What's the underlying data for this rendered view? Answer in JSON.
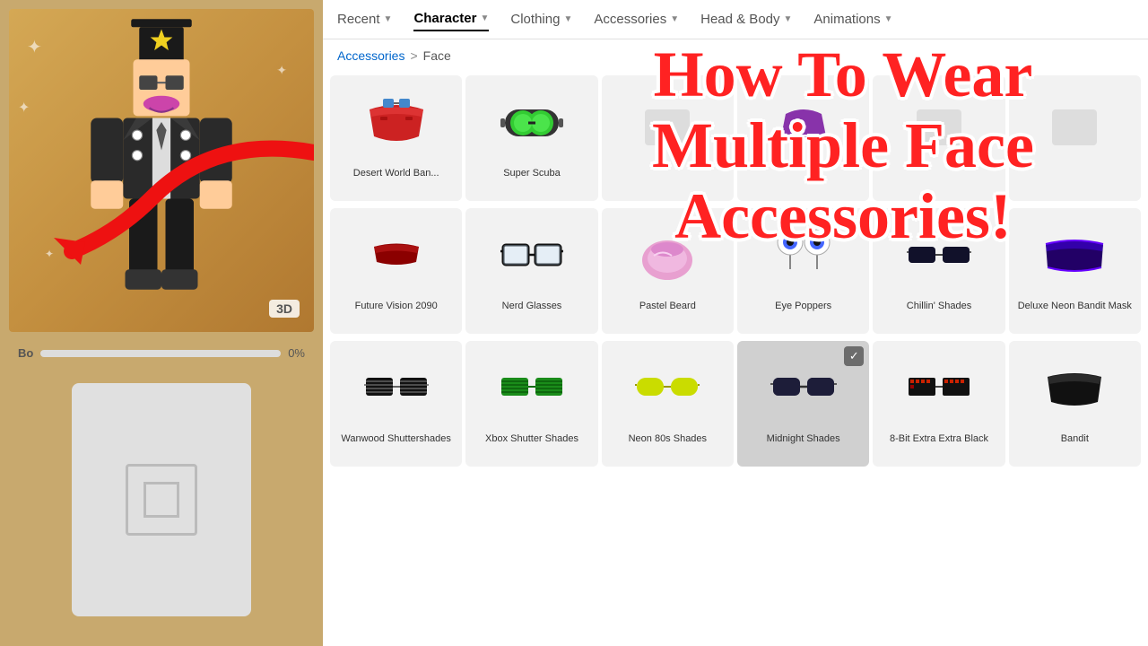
{
  "nav": {
    "items": [
      {
        "label": "Recent",
        "hasChevron": true,
        "active": false
      },
      {
        "label": "Character",
        "hasChevron": true,
        "active": true
      },
      {
        "label": "Clothing",
        "hasChevron": true,
        "active": false
      },
      {
        "label": "Accessories",
        "hasChevron": true,
        "active": false
      },
      {
        "label": "Head & Body",
        "hasChevron": true,
        "active": false
      },
      {
        "label": "Animations",
        "hasChevron": true,
        "active": false
      }
    ]
  },
  "breadcrumb": {
    "parts": [
      "Accessories",
      ">",
      "Face"
    ]
  },
  "overlay": {
    "title": "How To Wear Multiple Face Accessories!"
  },
  "character": {
    "badge": "3D",
    "label": "Bo",
    "progress": "0%"
  },
  "items_row1": [
    {
      "name": "Desert World Ban...",
      "selected": false,
      "hasCheck": false
    },
    {
      "name": "Super Scuba",
      "selected": false,
      "hasCheck": false
    },
    {
      "name": "",
      "selected": false,
      "hasCheck": false
    },
    {
      "name": "",
      "selected": false,
      "hasCheck": false
    },
    {
      "name": "",
      "selected": false,
      "hasCheck": false
    },
    {
      "name": "",
      "selected": false,
      "hasCheck": false
    }
  ],
  "items_row2": [
    {
      "name": "Future Vision 2090",
      "selected": false,
      "hasCheck": false
    },
    {
      "name": "Nerd Glasses",
      "selected": false,
      "hasCheck": false
    },
    {
      "name": "Pastel Beard",
      "selected": false,
      "hasCheck": false
    },
    {
      "name": "Eye Poppers",
      "selected": false,
      "hasCheck": false
    },
    {
      "name": "Chillin' Shades",
      "selected": false,
      "hasCheck": false
    },
    {
      "name": "Deluxe Neon Bandit Mask",
      "selected": false,
      "hasCheck": false
    }
  ],
  "items_row3": [
    {
      "name": "Wanwood Shuttershades",
      "selected": false,
      "hasCheck": false
    },
    {
      "name": "Xbox Shutter Shades",
      "selected": false,
      "hasCheck": false
    },
    {
      "name": "Neon 80s Shades",
      "selected": false,
      "hasCheck": false
    },
    {
      "name": "Midnight Shades",
      "selected": true,
      "hasCheck": true
    },
    {
      "name": "8-Bit Extra Extra Black",
      "selected": false,
      "hasCheck": false
    },
    {
      "name": "Bandit",
      "selected": false,
      "hasCheck": false
    }
  ]
}
